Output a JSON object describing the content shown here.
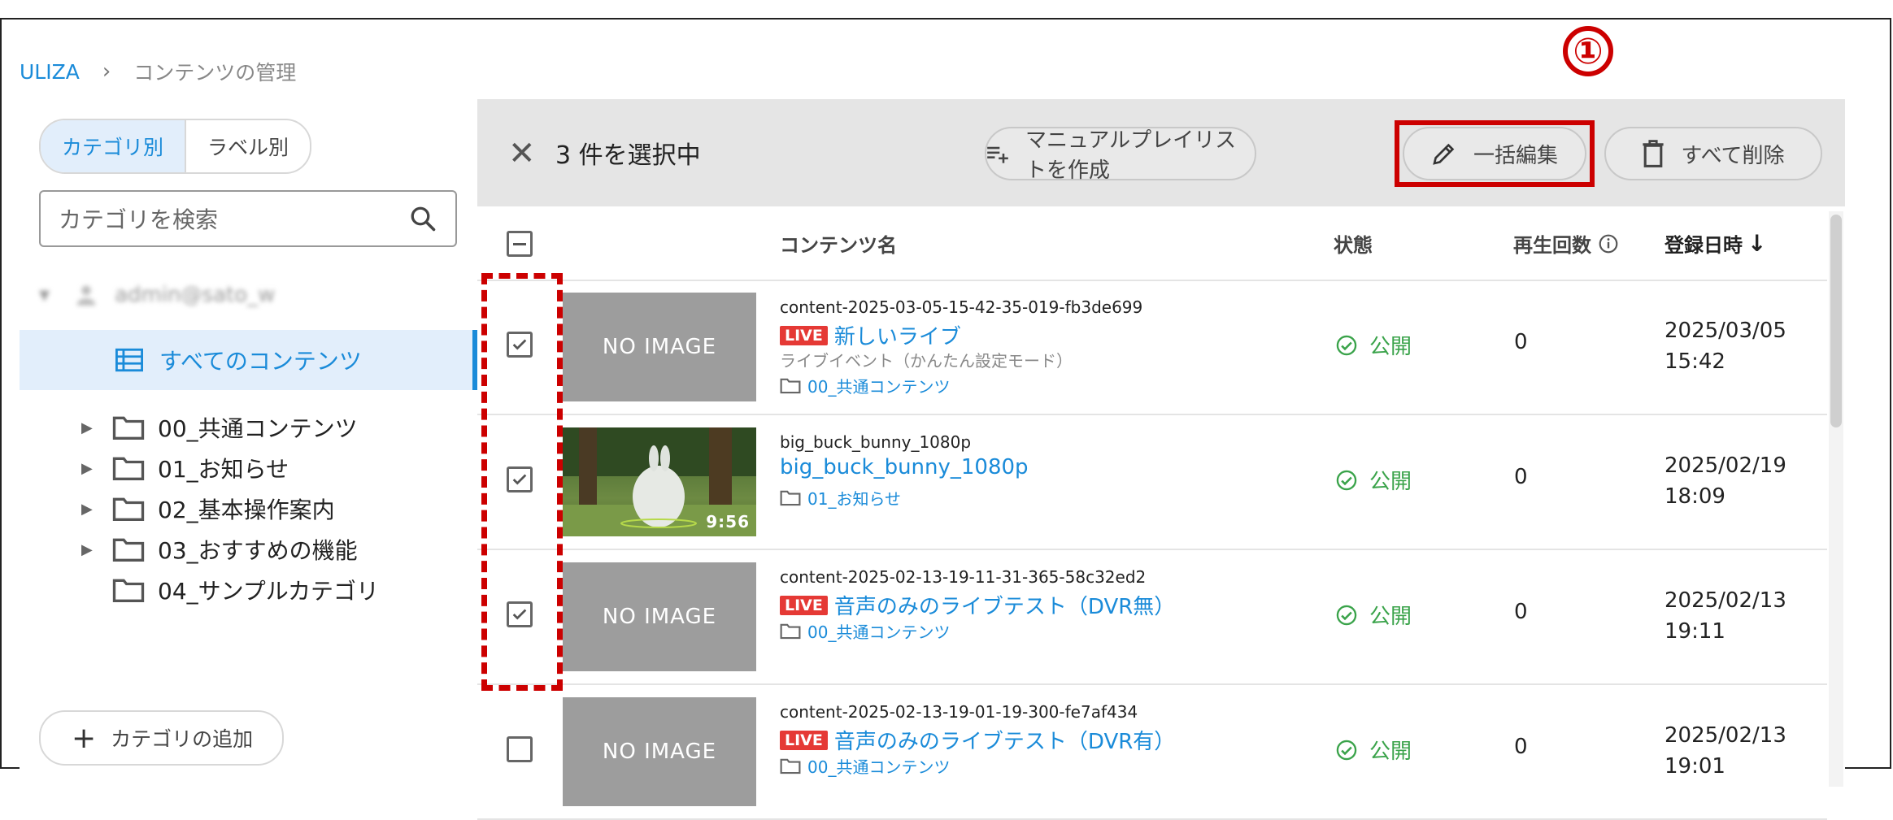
{
  "breadcrumb": {
    "root": "ULIZA",
    "separator": "›",
    "current": "コンテンツの管理"
  },
  "sidebar": {
    "tabs": [
      {
        "label": "カテゴリ別",
        "active": true
      },
      {
        "label": "ラベル別",
        "active": false
      }
    ],
    "search_placeholder": "カテゴリを検索",
    "user": "admin@sato_w",
    "all_contents": "すべてのコンテンツ",
    "categories": [
      {
        "label": "00_共通コンテンツ",
        "expandable": true
      },
      {
        "label": "01_お知らせ",
        "expandable": true
      },
      {
        "label": "02_基本操作案内",
        "expandable": true
      },
      {
        "label": "03_おすすめの機能",
        "expandable": true
      },
      {
        "label": "04_サンプルカテゴリ",
        "expandable": false
      }
    ],
    "add_category": "カテゴリの追加"
  },
  "toolbar": {
    "selected_count": "3 件を選択中",
    "create_playlist": "マニュアルプレイリストを作成",
    "bulk_edit": "一括編集",
    "delete_all": "すべて削除",
    "annotation": "①"
  },
  "table": {
    "headers": {
      "name": "コンテンツ名",
      "status": "状態",
      "plays": "再生回数",
      "registered": "登録日時"
    },
    "rows": [
      {
        "checked": true,
        "thumb": "NO IMAGE",
        "id": "content-2025-03-05-15-42-35-019-fb3de699",
        "live": "LIVE",
        "title": "新しいライブ",
        "subtitle": "ライブイベント（かんたん設定モード）",
        "folder": "00_共通コンテンツ",
        "status": "公開",
        "plays": "0",
        "date": "2025/03/05",
        "time": "15:42"
      },
      {
        "checked": true,
        "thumb": "",
        "duration": "9:56",
        "id": "big_buck_bunny_1080p",
        "live": "",
        "title": "big_buck_bunny_1080p",
        "subtitle": "",
        "folder": "01_お知らせ",
        "status": "公開",
        "plays": "0",
        "date": "2025/02/19",
        "time": "18:09"
      },
      {
        "checked": true,
        "thumb": "NO IMAGE",
        "id": "content-2025-02-13-19-11-31-365-58c32ed2",
        "live": "LIVE",
        "title": "音声のみのライブテスト（DVR無）",
        "subtitle": "",
        "folder": "00_共通コンテンツ",
        "status": "公開",
        "plays": "0",
        "date": "2025/02/13",
        "time": "19:11"
      },
      {
        "checked": false,
        "thumb": "NO IMAGE",
        "id": "content-2025-02-13-19-01-19-300-fe7af434",
        "live": "LIVE",
        "title": "音声のみのライブテスト（DVR有）",
        "subtitle": "",
        "folder": "00_共通コンテンツ",
        "status": "公開",
        "plays": "0",
        "date": "2025/02/13",
        "time": "19:01"
      }
    ]
  },
  "colors": {
    "accent": "#1a8bd9",
    "live": "#e53935",
    "status_green": "#3aa34a",
    "annotation_red": "#cc0000"
  }
}
